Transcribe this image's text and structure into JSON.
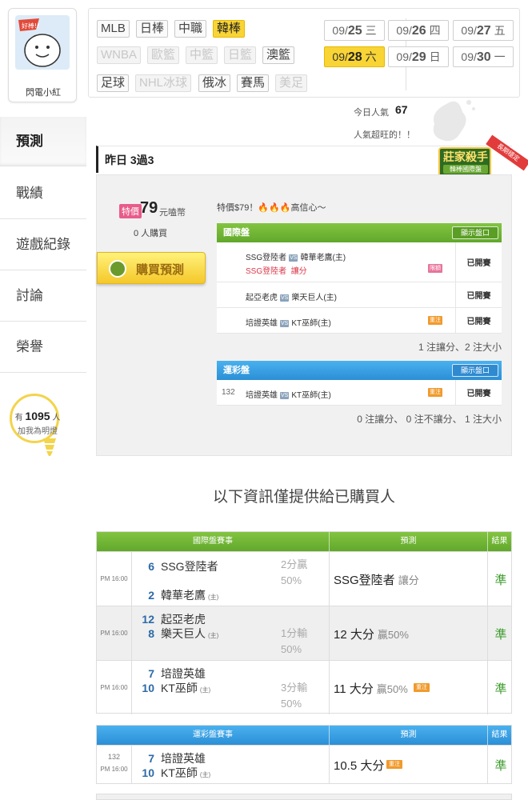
{
  "user": {
    "name": "閃電小紅",
    "fans_prefix": "有",
    "fans_count": "1095",
    "fans_suffix": "人",
    "fans_cta": "加我為明燈"
  },
  "nav": {
    "items": [
      {
        "label": "預測",
        "active": true
      },
      {
        "label": "戰績"
      },
      {
        "label": "遊戲紀錄"
      },
      {
        "label": "討論"
      },
      {
        "label": "榮譽"
      }
    ]
  },
  "sports": {
    "row1": [
      {
        "label": "MLB",
        "state": "normal"
      },
      {
        "label": "日棒",
        "state": "normal"
      },
      {
        "label": "中職",
        "state": "normal"
      },
      {
        "label": "韓棒",
        "state": "on"
      }
    ],
    "row2": [
      {
        "label": "WNBA",
        "state": "off"
      },
      {
        "label": "歐籃",
        "state": "off"
      },
      {
        "label": "中籃",
        "state": "off"
      },
      {
        "label": "日籃",
        "state": "off"
      },
      {
        "label": "澳籃",
        "state": "normal"
      }
    ],
    "row3": [
      {
        "label": "足球",
        "state": "normal"
      },
      {
        "label": "NHL冰球",
        "state": "off"
      },
      {
        "label": "俄冰",
        "state": "normal"
      },
      {
        "label": "賽馬",
        "state": "normal"
      },
      {
        "label": "美足",
        "state": "off"
      }
    ]
  },
  "dates": [
    {
      "md": "09/",
      "day": "25",
      "wd": "三",
      "selected": false
    },
    {
      "md": "09/",
      "day": "26",
      "wd": "四",
      "selected": false
    },
    {
      "md": "09/",
      "day": "27",
      "wd": "五",
      "selected": false
    },
    {
      "md": "09/",
      "day": "28",
      "wd": "六",
      "selected": true
    },
    {
      "md": "09/",
      "day": "29",
      "wd": "日",
      "selected": false
    },
    {
      "md": "09/",
      "day": "30",
      "wd": "一",
      "selected": false
    }
  ],
  "popularity": {
    "label": "今日人氣",
    "value": "67",
    "message": "人氣超旺的！！"
  },
  "badge": {
    "title": "莊家殺手",
    "subtitle": "韓棒國際盤",
    "ribbon": "長期穩定"
  },
  "yesterday": "昨日 3過3",
  "offer": {
    "tag": "特價",
    "price": "79",
    "unit": "元嗑幣",
    "buyers": "0 人購買",
    "buy_label": "購買預測",
    "buy_icon": "coin-icon",
    "promo": "特價$79！🔥🔥🔥高信心～"
  },
  "intl_board": {
    "title": "國際盤",
    "show_label": "顯示盤口",
    "rows": [
      {
        "away": "SSG登陸者",
        "home": "韓華老鷹(主)",
        "pick": "SSG登陸者",
        "pick_type": "讓分",
        "badge": "限額",
        "status": "已開賽"
      },
      {
        "away": "起亞老虎",
        "home": "樂天巨人(主)",
        "status": "已開賽"
      },
      {
        "away": "培證英雄",
        "home": "KT巫師(主)",
        "badge": "重注",
        "status": "已開賽"
      }
    ],
    "summary": "1 注讓分、2 注大小"
  },
  "sport_lottery": {
    "title": "運彩盤",
    "show_label": "顯示盤口",
    "rows": [
      {
        "no": "132",
        "away": "培證英雄",
        "home": "KT巫師(主)",
        "badge": "重注",
        "status": "已開賽"
      }
    ],
    "summary": "0 注讓分、 0 注不讓分、 1 注大小"
  },
  "notice": "以下資訊僅提供給已購買人",
  "results_intl": {
    "headers": {
      "match": "國際盤賽事",
      "pred": "預測",
      "result": "結果"
    },
    "rows": [
      {
        "time": "PM 16:00",
        "t1_no": "6",
        "t1": "SSG登陸者",
        "t2_no": "2",
        "t2": "韓華老鷹",
        "host": "(主)",
        "odds1": "2分贏",
        "odds2": "50%",
        "pred": "SSG登陸者",
        "pred_sub": "讓分",
        "result": "準"
      },
      {
        "time": "PM 16:00",
        "t1_no": "12",
        "t1": "起亞老虎",
        "t2_no": "8",
        "t2": "樂天巨人",
        "host": "(主)",
        "odds1": "1分輸",
        "odds2": "50%",
        "pred": "12 大分",
        "pred_sub": "贏50%",
        "result": "準"
      },
      {
        "time": "PM 16:00",
        "t1_no": "7",
        "t1": "培證英雄",
        "t2_no": "10",
        "t2": "KT巫師",
        "host": "(主)",
        "odds1": "3分輸",
        "odds2": "50%",
        "pred": "11 大分",
        "pred_sub": "贏50%",
        "badge": "重注",
        "result": "準"
      }
    ]
  },
  "results_lottery": {
    "headers": {
      "match": "運彩盤賽事",
      "pred": "預測",
      "result": "結果"
    },
    "rows": [
      {
        "no": "132",
        "time": "PM 16:00",
        "t1_no": "7",
        "t1": "培證英雄",
        "t2_no": "10",
        "t2": "KT巫師",
        "host": "(主)",
        "pred": "10.5 大分",
        "badge": "重注",
        "result": "準"
      }
    ]
  },
  "colors": {
    "accent_yellow": "#f9d435",
    "green_header": "#6cb433",
    "blue_header": "#3aa0e3",
    "win_green": "#3a9a2a"
  }
}
